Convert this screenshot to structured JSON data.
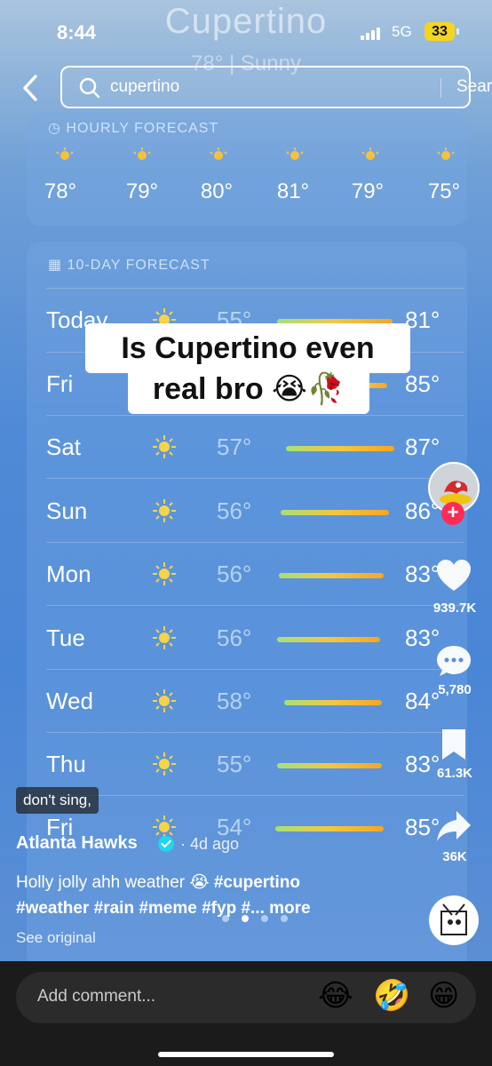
{
  "status": {
    "time": "8:44",
    "network": "5G",
    "battery": "33"
  },
  "weather_bg": {
    "city": "Cupertino",
    "summary": "78° | Sunny"
  },
  "search": {
    "query": "cupertino",
    "button": "Search"
  },
  "hourly": {
    "title": "HOURLY FORECAST",
    "temps": [
      "78°",
      "79°",
      "80°",
      "81°",
      "79°",
      "75°"
    ]
  },
  "daily": {
    "title": "10-DAY FORECAST",
    "days": [
      {
        "name": "Today",
        "low": "55°",
        "high": "81°"
      },
      {
        "name": "Fri",
        "low": "",
        "high": "85°"
      },
      {
        "name": "Sat",
        "low": "57°",
        "high": "87°"
      },
      {
        "name": "Sun",
        "low": "56°",
        "high": "86°"
      },
      {
        "name": "Mon",
        "low": "56°",
        "high": "83°"
      },
      {
        "name": "Tue",
        "low": "56°",
        "high": "83°"
      },
      {
        "name": "Wed",
        "low": "58°",
        "high": "84°"
      },
      {
        "name": "Thu",
        "low": "55°",
        "high": "83°"
      },
      {
        "name": "Fri",
        "low": "54°",
        "high": "85°"
      }
    ]
  },
  "caption": {
    "line1": "Is Cupertino even",
    "line2": "real bro 😭🥀"
  },
  "actions": {
    "likes": "939.7K",
    "comments": "5,780",
    "saves": "61.3K",
    "shares": "36K"
  },
  "post": {
    "sound_tag": "don't sing,",
    "author": "Atlanta Hawks",
    "ago": "· 4d ago",
    "description": "Holly jolly ahh weather 😭",
    "hashtags": "#cupertino #weather #rain #meme #fyp #...",
    "more": "more",
    "see_original": "See original"
  },
  "comment_bar": {
    "placeholder": "Add comment...",
    "emojis": [
      "😂",
      "🤣",
      "😁"
    ]
  },
  "colors": {
    "accent_red": "#fe2c55",
    "verified_blue": "#20d5ec",
    "battery_yellow": "#f4d51f"
  }
}
